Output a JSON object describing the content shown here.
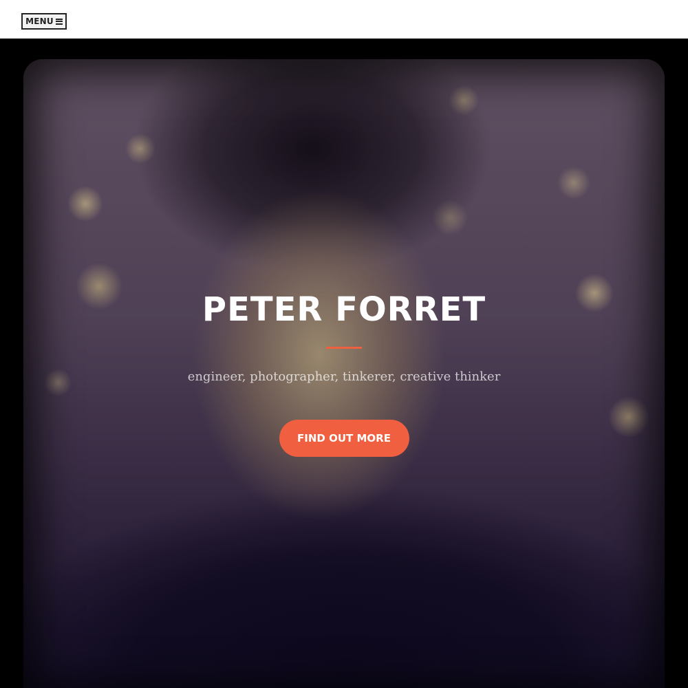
{
  "nav": {
    "menu_label": "MENU",
    "menu_icon": "hamburger-icon"
  },
  "hero": {
    "title": "PETER FORRET",
    "subtitle": "engineer, photographer, tinkerer, creative thinker",
    "cta_label": "FIND OUT MORE",
    "image": "portrait-photo"
  },
  "colors": {
    "accent": "#f05f40",
    "topbar_bg": "#ffffff",
    "hero_bg": "#000000",
    "title_text": "#ffffff"
  }
}
